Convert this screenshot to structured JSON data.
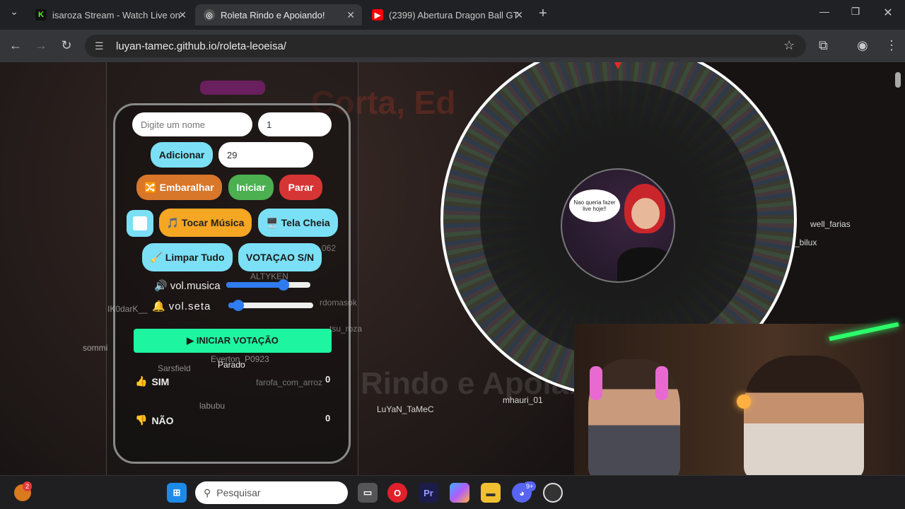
{
  "browser": {
    "tabs": [
      {
        "title": "isaroza Stream - Watch Live on",
        "active": false
      },
      {
        "title": "Roleta Rindo e Apoiando!",
        "active": true
      },
      {
        "title": "(2399) Abertura Dragon Ball GT",
        "active": false
      }
    ],
    "url": "luyan-tamec.github.io/roleta-leoeisa/"
  },
  "form": {
    "name_placeholder": "Digite um nome",
    "quantity_value": "1",
    "add_label": "Adicionar",
    "number_value": "29",
    "shuffle_label": "🔀 Embaralhar",
    "start_label": "Iniciar",
    "stop_label": "Parar",
    "music_label": "🎵 Tocar Música",
    "fullscreen_label": "🖥️ Tela Cheia",
    "clear_label": "🧹 Limpar Tudo",
    "vote_label": "VOTAÇAO S/N",
    "vol_music_label": "vol.musica",
    "vol_arrow_label": "vol.seta",
    "vol_music_level": 0.68,
    "vol_arrow_level": 0.12
  },
  "voting": {
    "start_label": "▶ INICIAR VOTAÇÃO",
    "status": "Parado",
    "yes_label": "SIM",
    "no_label": "NÃO",
    "yes_count": "0",
    "no_count": "0"
  },
  "wheel": {
    "center_text": "Nao queria fazer live hoje!!"
  },
  "chat_names": [
    "well_farias",
    "_bilux",
    "LuYaN_TaMeC",
    "mhauri_01",
    "ALTYKEN",
    "Sarsfield",
    "labubu",
    "sommi",
    "IK0darK__",
    "farofa_com_arroz",
    "rdomasok",
    "tsu_roza",
    "Everton_P0923",
    "062"
  ],
  "taskbar": {
    "search_placeholder": "Pesquisar",
    "notification_count": "2",
    "discord_badge": "9+"
  },
  "colors": {
    "accent_cyan": "#7be0f5",
    "vote_green": "#1df5a0",
    "slider_blue": "#2f7bf0"
  }
}
